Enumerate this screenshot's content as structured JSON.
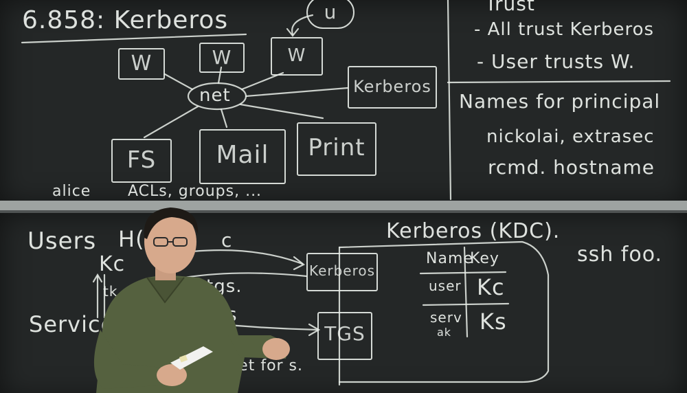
{
  "top_board": {
    "title": "6.858: Kerberos",
    "net_label": "net",
    "u_label": "u",
    "w_labels": [
      "W",
      "W",
      "W"
    ],
    "kerberos_box": "Kerberos",
    "service_boxes": [
      "FS",
      "Mail",
      "Print"
    ],
    "alice_label": "alice",
    "acls_label": "ACLs, groups, ..."
  },
  "trust_panel": {
    "heading": "Trust",
    "lines": [
      "- All trust Kerberos",
      "- User trusts W."
    ]
  },
  "names_panel": {
    "heading": "Names for principal",
    "lines": [
      "nickolai, extrasec",
      "rcmd. hostname"
    ]
  },
  "bottom_board": {
    "users_label": "Users",
    "h_label": "H(",
    "kc_label": "Kc",
    "tkt_label": "tk",
    "service_label": "Service",
    "arrow_c": "c",
    "arrow_tgs": "tgs.",
    "arrow_s": "s",
    "ticket_label": "icket for s.",
    "kerberos_small_box": "Kerberos",
    "tgs_box": "TGS",
    "kdc_heading": "Kerberos (KDC).",
    "ssh_label": "ssh foo.",
    "table": {
      "headers": [
        "Name",
        "Key"
      ],
      "rows": [
        {
          "name": "user",
          "key": "Kc"
        },
        {
          "name": "serv",
          "name_sub": "ak",
          "key": "Ks"
        }
      ]
    }
  }
}
